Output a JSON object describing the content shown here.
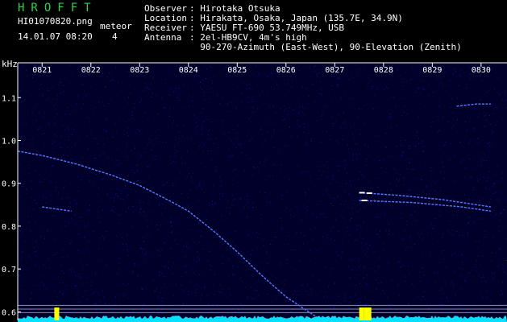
{
  "header": {
    "brand": "HROFFT",
    "filename": "HI01070820.png",
    "datetime": "14.01.07 08:20",
    "meteor_label": "meteor",
    "meteor_count": "4",
    "fields": [
      {
        "key": "Observer",
        "value": ": Hirotaka Otsuka"
      },
      {
        "key": "Location",
        "value": ": Hirakata, Osaka, Japan (135.7E, 34.9N)"
      },
      {
        "key": "Receiver",
        "value": ": YAESU FT-690 53.749MHz, USB"
      },
      {
        "key": "Antenna",
        "value": ": 2el-HB9CV, 4m's high"
      },
      {
        "key": "",
        "value": "  90-270-Azimuth (East-West), 90-Elevation (Zenith)"
      }
    ]
  },
  "chart_data": {
    "type": "heatmap",
    "title": "",
    "ylabel": "kHz",
    "xlabel": "",
    "x_ticks": [
      "0821",
      "0822",
      "0823",
      "0824",
      "0825",
      "0826",
      "0827",
      "0828",
      "0829",
      "0830"
    ],
    "y_ticks": [
      1.1,
      1.0,
      0.9,
      0.8,
      0.7,
      0.6
    ],
    "ylim": [
      0.58,
      1.17
    ],
    "xlim": [
      820.5,
      830.3
    ],
    "colors": {
      "background": "#00002a",
      "noise": "#1818a0",
      "trace": "#5a78ff",
      "bright": "#ffffff",
      "meteor_bar": "#ffff00",
      "baseline": "#00e0ff"
    },
    "traces": [
      {
        "points": [
          [
            820.5,
            0.975
          ],
          [
            821.0,
            0.965
          ],
          [
            821.7,
            0.945
          ],
          [
            822.4,
            0.92
          ],
          [
            823.0,
            0.895
          ],
          [
            823.6,
            0.86
          ],
          [
            824.0,
            0.835
          ],
          [
            824.5,
            0.79
          ],
          [
            825.0,
            0.74
          ],
          [
            825.5,
            0.685
          ],
          [
            826.0,
            0.635
          ],
          [
            826.6,
            0.59
          ]
        ]
      },
      {
        "points": [
          [
            821.0,
            0.845
          ],
          [
            821.6,
            0.835
          ]
        ]
      },
      {
        "points": [
          [
            827.5,
            0.878
          ],
          [
            828.3,
            0.872
          ],
          [
            829.2,
            0.862
          ],
          [
            830.2,
            0.845
          ]
        ]
      },
      {
        "points": [
          [
            827.5,
            0.86
          ],
          [
            828.6,
            0.855
          ],
          [
            829.6,
            0.845
          ],
          [
            830.2,
            0.835
          ]
        ]
      },
      {
        "points": [
          [
            829.5,
            1.08
          ],
          [
            829.9,
            1.085
          ],
          [
            830.2,
            1.085
          ]
        ]
      }
    ],
    "bright_points": [
      [
        827.55,
        0.878
      ],
      [
        827.6,
        0.86
      ],
      [
        827.7,
        0.877
      ]
    ],
    "meteor_bars": [
      827.55,
      827.65,
      827.7,
      821.3
    ]
  }
}
